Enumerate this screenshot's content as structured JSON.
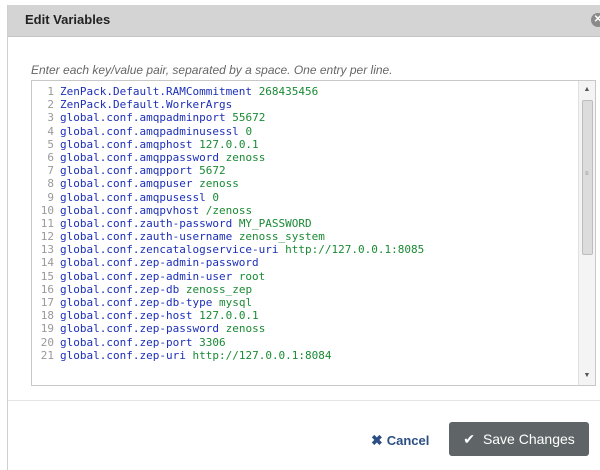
{
  "dialog": {
    "title": "Edit Variables",
    "close_icon": "close-icon",
    "instructions": "Enter each key/value pair, separated by a space. One entry per line.",
    "cancel_label": "Cancel",
    "save_label": "Save Changes"
  },
  "lines": [
    {
      "n": "1",
      "key": "ZenPack.Default.RAMCommitment",
      "value": "268435456"
    },
    {
      "n": "2",
      "key": "ZenPack.Default.WorkerArgs",
      "value": ""
    },
    {
      "n": "3",
      "key": "global.conf.amqpadminport",
      "value": "55672"
    },
    {
      "n": "4",
      "key": "global.conf.amqpadminusessl",
      "value": "0"
    },
    {
      "n": "5",
      "key": "global.conf.amqphost",
      "value": "127.0.0.1"
    },
    {
      "n": "6",
      "key": "global.conf.amqppassword",
      "value": "zenoss"
    },
    {
      "n": "7",
      "key": "global.conf.amqpport",
      "value": "5672"
    },
    {
      "n": "8",
      "key": "global.conf.amqpuser",
      "value": "zenoss"
    },
    {
      "n": "9",
      "key": "global.conf.amqpusessl",
      "value": "0"
    },
    {
      "n": "10",
      "key": "global.conf.amqpvhost",
      "value": "/zenoss"
    },
    {
      "n": "11",
      "key": "global.conf.zauth-password",
      "value": "MY_PASSWORD"
    },
    {
      "n": "12",
      "key": "global.conf.zauth-username",
      "value": "zenoss_system"
    },
    {
      "n": "13",
      "key": "global.conf.zencatalogservice-uri",
      "value": "http://127.0.0.1:8085"
    },
    {
      "n": "14",
      "key": "global.conf.zep-admin-password",
      "value": ""
    },
    {
      "n": "15",
      "key": "global.conf.zep-admin-user",
      "value": "root"
    },
    {
      "n": "16",
      "key": "global.conf.zep-db",
      "value": "zenoss_zep"
    },
    {
      "n": "17",
      "key": "global.conf.zep-db-type",
      "value": "mysql"
    },
    {
      "n": "18",
      "key": "global.conf.zep-host",
      "value": "127.0.0.1"
    },
    {
      "n": "19",
      "key": "global.conf.zep-password",
      "value": "zenoss"
    },
    {
      "n": "20",
      "key": "global.conf.zep-port",
      "value": "3306"
    },
    {
      "n": "21",
      "key": "global.conf.zep-uri",
      "value": "http://127.0.0.1:8084"
    }
  ],
  "colors": {
    "key": "#1c2fb8",
    "value": "#1a8a34",
    "title_bar": "#d4d4d4",
    "save_button": "#5f6466",
    "cancel_text": "#2d4f86"
  }
}
